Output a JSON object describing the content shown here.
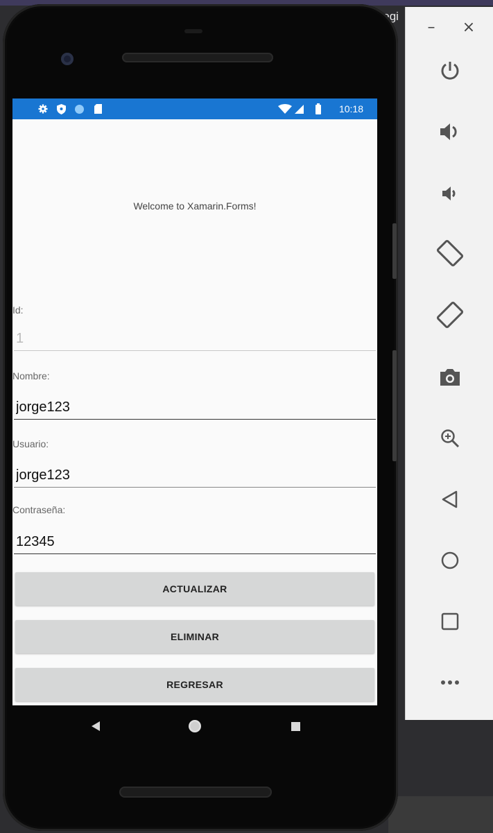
{
  "background": {
    "ide_title_fragment": "Regi"
  },
  "statusbar": {
    "time": "10:18",
    "left_icons": [
      "settings-icon",
      "shield-icon",
      "circle-icon",
      "sd-card-icon"
    ],
    "right_icons": [
      "wifi-icon",
      "signal-icon",
      "battery-icon"
    ],
    "color": "#1976d2"
  },
  "app": {
    "welcome": "Welcome to Xamarin.Forms!",
    "fields": {
      "id": {
        "label": "Id:",
        "value": "1"
      },
      "nombre": {
        "label": "Nombre:",
        "value": "jorge123"
      },
      "usuario": {
        "label": "Usuario:",
        "value": "jorge123"
      },
      "contrasena": {
        "label": "Contraseña:",
        "value": "12345"
      }
    },
    "buttons": {
      "actualizar": "ACTUALIZAR",
      "eliminar": "ELIMINAR",
      "regresar": "REGRESAR"
    }
  },
  "navbar": [
    "back-icon",
    "home-icon",
    "recents-icon"
  ],
  "emulator_toolbar": {
    "minimize": "–",
    "close": "×",
    "tools": [
      "power-icon",
      "volume-up-icon",
      "volume-down-icon",
      "rotate-left-icon",
      "rotate-right-icon",
      "camera-icon",
      "zoom-icon",
      "back-icon",
      "home-icon",
      "overview-icon",
      "more-icon"
    ]
  }
}
